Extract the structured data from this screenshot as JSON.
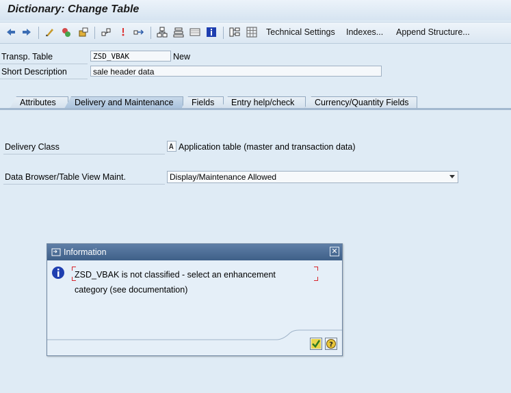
{
  "window": {
    "title": "Dictionary: Change Table"
  },
  "toolbar": {
    "icons": [
      "back-icon",
      "forward-icon",
      "toggle-display-change-icon",
      "check-icon",
      "activate-icon",
      "where-used-icon",
      "object-list-icon",
      "navigate-icon",
      "hierarchy-icon",
      "display-object-list-icon",
      "table-contents-icon",
      "info-icon",
      "structure-icon",
      "grid-icon"
    ],
    "technical_settings": "Technical Settings",
    "indexes": "Indexes...",
    "append_structure": "Append Structure..."
  },
  "header": {
    "table_label": "Transp. Table",
    "table_value": "ZSD_VBAK",
    "table_status": "New",
    "short_desc_label": "Short Description",
    "short_desc_value": "sale header data"
  },
  "tabs": [
    {
      "label": "Attributes",
      "active": false
    },
    {
      "label": "Delivery and Maintenance",
      "active": true
    },
    {
      "label": "Fields",
      "active": false
    },
    {
      "label": "Entry help/check",
      "active": false
    },
    {
      "label": "Currency/Quantity Fields",
      "active": false
    }
  ],
  "delivery": {
    "class_label": "Delivery Class",
    "class_value": "A",
    "class_desc": "Application table (master and transaction data)",
    "browser_label": "Data Browser/Table View Maint.",
    "browser_value": "Display/Maintenance Allowed"
  },
  "dialog": {
    "title": "Information",
    "message": "ZSD_VBAK is not classified - select an enhancement category (see documentation)"
  },
  "colors": {
    "accent": "#3e5f88",
    "background": "#dfebf5",
    "info_blue": "#1f3fb0"
  }
}
